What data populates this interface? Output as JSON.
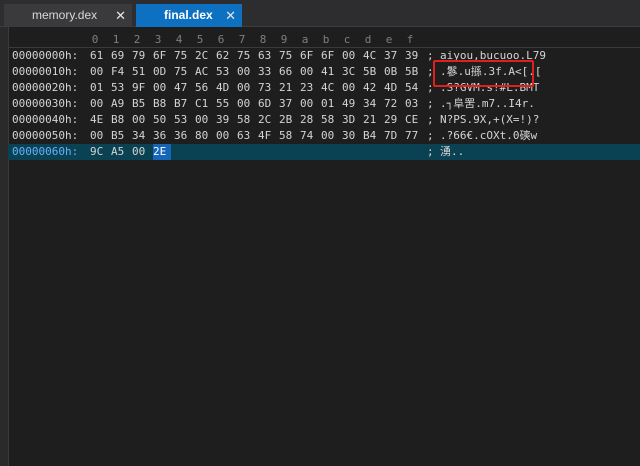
{
  "tabs": [
    {
      "label": "memory.dex",
      "close": "✕",
      "active": false
    },
    {
      "label": "final.dex",
      "close": "✕",
      "active": true
    }
  ],
  "ruler": [
    "0",
    "1",
    "2",
    "3",
    "4",
    "5",
    "6",
    "7",
    "8",
    "9",
    "a",
    "b",
    "c",
    "d",
    "e",
    "f"
  ],
  "separator": ";",
  "rows": [
    {
      "address": "00000000h:",
      "bytes": [
        "61",
        "69",
        "79",
        "6F",
        "75",
        "2C",
        "62",
        "75",
        "63",
        "75",
        "6F",
        "6F",
        "00",
        "4C",
        "37",
        "39"
      ],
      "ascii": "aiyou,bucuoo.L79"
    },
    {
      "address": "00000010h:",
      "bytes": [
        "00",
        "F4",
        "51",
        "0D",
        "75",
        "AC",
        "53",
        "00",
        "33",
        "66",
        "00",
        "41",
        "3C",
        "5B",
        "0B",
        "5B"
      ],
      "ascii": ".鬖.u搎.3f.A<[.["
    },
    {
      "address": "00000020h:",
      "bytes": [
        "01",
        "53",
        "9F",
        "00",
        "47",
        "56",
        "4D",
        "00",
        "73",
        "21",
        "23",
        "4C",
        "00",
        "42",
        "4D",
        "54"
      ],
      "ascii": ".S?GVM.s!#L.BMT"
    },
    {
      "address": "00000030h:",
      "bytes": [
        "00",
        "A9",
        "B5",
        "B8",
        "B7",
        "C1",
        "55",
        "00",
        "6D",
        "37",
        "00",
        "01",
        "49",
        "34",
        "72",
        "03"
      ],
      "ascii": ".┐阜罟.m7..I4r."
    },
    {
      "address": "00000040h:",
      "bytes": [
        "4E",
        "B8",
        "00",
        "50",
        "53",
        "00",
        "39",
        "58",
        "2C",
        "2B",
        "28",
        "58",
        "3D",
        "21",
        "29",
        "CE"
      ],
      "ascii": "N?PS.9X,+(X=!)?"
    },
    {
      "address": "00000050h:",
      "bytes": [
        "00",
        "B5",
        "34",
        "36",
        "36",
        "80",
        "00",
        "63",
        "4F",
        "58",
        "74",
        "00",
        "30",
        "B4",
        "7D",
        "77"
      ],
      "ascii": ".?66€.cOXt.0磢w"
    },
    {
      "address": "00000060h:",
      "bytes": [
        "9C",
        "A5",
        "00",
        "2E"
      ],
      "ascii": "湧..",
      "current": true,
      "selected_byte": 3
    }
  ],
  "colors": {
    "tab_active": "#0e70c0",
    "highlight_box": "#e0201c",
    "current_row": "#0b4253",
    "selected_byte": "#1666b8"
  }
}
